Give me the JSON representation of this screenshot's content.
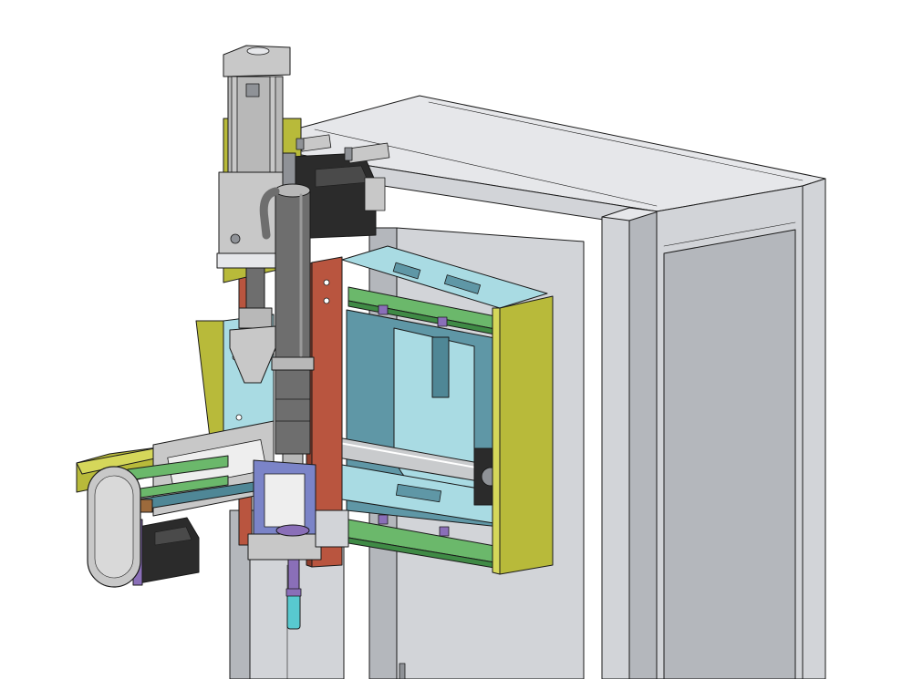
{
  "scene": {
    "background": "#ffffff",
    "line_color": "#1a1a1a"
  },
  "palette": {
    "frame_light": "#d2d4d8",
    "frame_mid": "#b4b7bc",
    "frame_dark": "#8f9297",
    "frame_top": "#e6e7ea",
    "carriage_blue": "#a9dbe3",
    "carriage_blue_shade": "#5f97a6",
    "carriage_blue_dark": "#4f8796",
    "rail_green": "#6bb86b",
    "rail_green_dark": "#3f8a45",
    "yellow_panel": "#b8ba3a",
    "yellow_panel_light": "#d5d75a",
    "red_plate": "#b9553f",
    "red_plate_dark": "#8e3d2c",
    "cylinder_grey": "#b8b8b8",
    "cylinder_dark": "#6e6e6e",
    "motor_black": "#2b2b2b",
    "bracket_grey": "#c8c8c8",
    "purple_part": "#8a6fb8",
    "cyan_tip": "#58c9cf",
    "shaft_silver": "#c9cbcd"
  }
}
